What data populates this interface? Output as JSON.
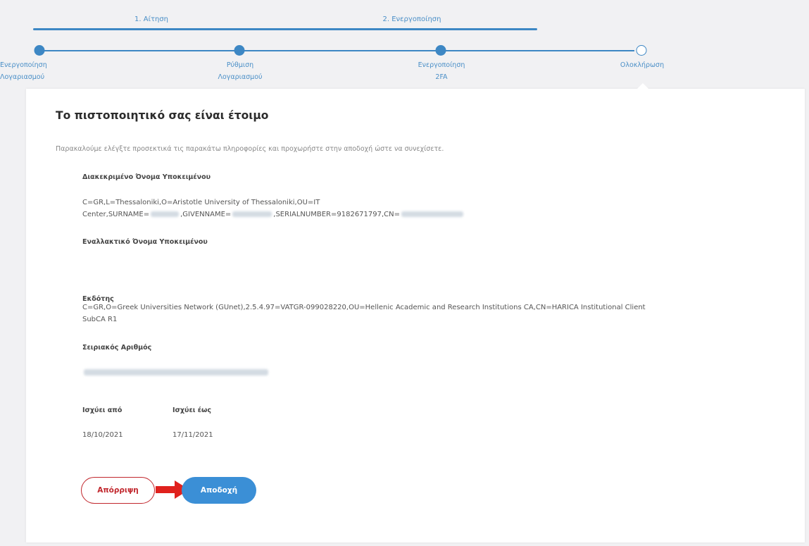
{
  "wizard": {
    "phases": [
      {
        "label": "1. Αίτηση"
      },
      {
        "label": "2. Ενεργοποίηση"
      }
    ],
    "steps": [
      {
        "label1": "Ενεργοποίηση",
        "label2": "Λογαριασμού"
      },
      {
        "label1": "Ρύθμιση",
        "label2": "Λογαριασμού"
      },
      {
        "label1": "Ενεργοποίηση",
        "label2": "2FA"
      },
      {
        "label1": "Ολοκλήρωση",
        "label2": ""
      }
    ],
    "current_step": 4,
    "accent_color": "#3d87c4"
  },
  "card": {
    "title": "Το πιστοποιητικό σας είναι έτοιμο",
    "subtitle": "Παρακαλούμε ελέγξτε προσεκτικά τις παρακάτω πληροφορίες και προχωρήστε στην αποδοχή ώστε να συνεχίσετε.",
    "subject_dn": {
      "label": "Διακεκριμένο Όνομα Υποκειμένου",
      "line1": "C=GR,L=Thessaloniki,O=Aristotle University of Thessaloniki,OU=IT",
      "line2_a": "Center,SURNAME=",
      "line2_b": ",GIVENNAME=",
      "line2_c": ",SERIALNUMBER=9182671797,CN="
    },
    "alt_name": {
      "label": "Εναλλακτικό Όνομα Υποκειμένου"
    },
    "issuer": {
      "label": "Εκδότης",
      "line1": "C=GR,O=Greek Universities Network (GUnet),2.5.4.97=VATGR-099028220,OU=Hellenic Academic and Research Institutions CA,CN=HARICA Institutional Client",
      "line2": "SubCA R1"
    },
    "serial": {
      "label": "Σειριακός Αριθμός"
    },
    "valid_from": {
      "label": "Ισχύει από",
      "value": "18/10/2021"
    },
    "valid_to": {
      "label": "Ισχύει έως",
      "value": "17/11/2021"
    },
    "reject_label": "Απόρριψη",
    "accept_label": "Αποδοχή",
    "reject_color": "#c1272d",
    "accept_color": "#3b8fd6"
  }
}
